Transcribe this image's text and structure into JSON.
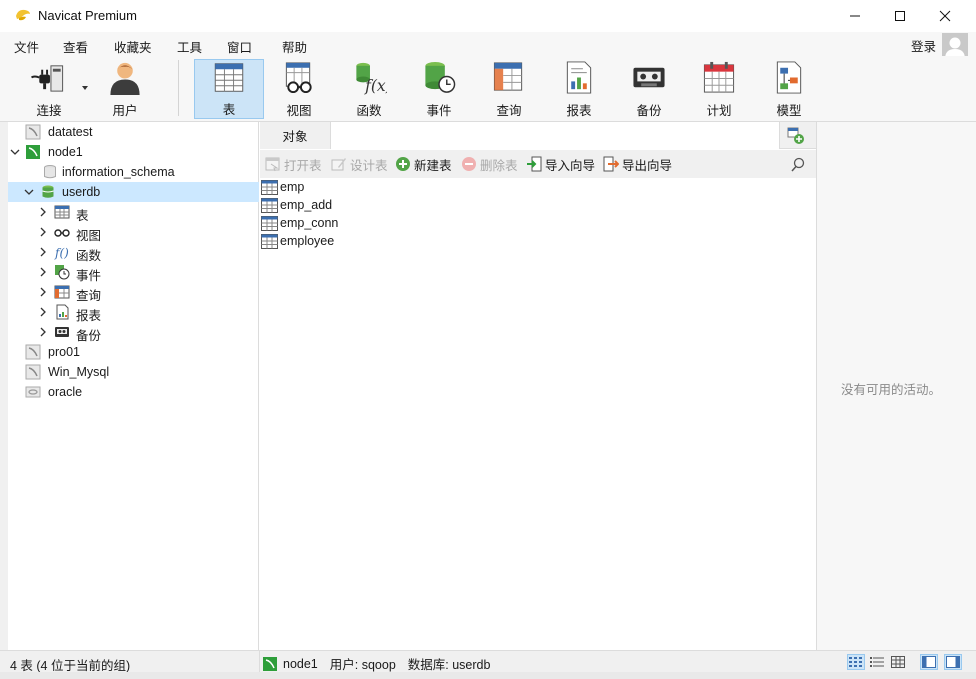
{
  "window": {
    "title": "Navicat Premium",
    "controls": {
      "minimize": "minimize-icon",
      "maximize": "maximize-icon",
      "close": "close-icon"
    }
  },
  "menu": {
    "items": [
      "文件",
      "查看",
      "收藏夹",
      "工具",
      "窗口",
      "帮助"
    ],
    "login_label": "登录"
  },
  "toolbar": {
    "items": [
      {
        "label": "连接",
        "icon": "connection-plug-icon"
      },
      {
        "label": "用户",
        "icon": "user-icon"
      },
      {
        "label": "表",
        "icon": "table-icon",
        "active": true
      },
      {
        "label": "视图",
        "icon": "view-glasses-icon"
      },
      {
        "label": "函数",
        "icon": "function-icon"
      },
      {
        "label": "事件",
        "icon": "event-clock-icon"
      },
      {
        "label": "查询",
        "icon": "query-icon"
      },
      {
        "label": "报表",
        "icon": "report-icon"
      },
      {
        "label": "备份",
        "icon": "backup-tape-icon"
      },
      {
        "label": "计划",
        "icon": "schedule-calendar-icon"
      },
      {
        "label": "模型",
        "icon": "model-icon"
      }
    ]
  },
  "navigator": {
    "connections": [
      {
        "label": "datatest",
        "type": "connection-closed"
      },
      {
        "label": "node1",
        "type": "connection-open",
        "expanded": true
      },
      {
        "label": "information_schema",
        "type": "database-closed"
      },
      {
        "label": "userdb",
        "type": "database-open",
        "expanded": true,
        "selected": true
      },
      {
        "label": "表",
        "type": "tables"
      },
      {
        "label": "视图",
        "type": "views"
      },
      {
        "label": "函数",
        "type": "functions"
      },
      {
        "label": "事件",
        "type": "events"
      },
      {
        "label": "查询",
        "type": "queries"
      },
      {
        "label": "报表",
        "type": "reports"
      },
      {
        "label": "备份",
        "type": "backups"
      },
      {
        "label": "pro01",
        "type": "connection-closed"
      },
      {
        "label": "Win_Mysql",
        "type": "connection-closed"
      },
      {
        "label": "oracle",
        "type": "connection-oracle"
      }
    ]
  },
  "objects": {
    "tab_label": "对象",
    "toolbar": {
      "open_table": "打开表",
      "design_table": "设计表",
      "new_table": "新建表",
      "delete_table": "删除表",
      "import_wizard": "导入向导",
      "export_wizard": "导出向导"
    },
    "tables": [
      "emp",
      "emp_add",
      "emp_conn",
      "employee"
    ]
  },
  "info_pane": {
    "empty_text": "没有可用的活动。"
  },
  "status": {
    "count_text": "4 表 (4 位于当前的组)",
    "connection": "node1",
    "user": "用户: sqoop",
    "database": "数据库: userdb"
  },
  "colors": {
    "accent_active": "#cce4f7",
    "selected_row": "#cce8ff",
    "mysql_green": "#2e9e3a",
    "db_green": "#52a447"
  }
}
